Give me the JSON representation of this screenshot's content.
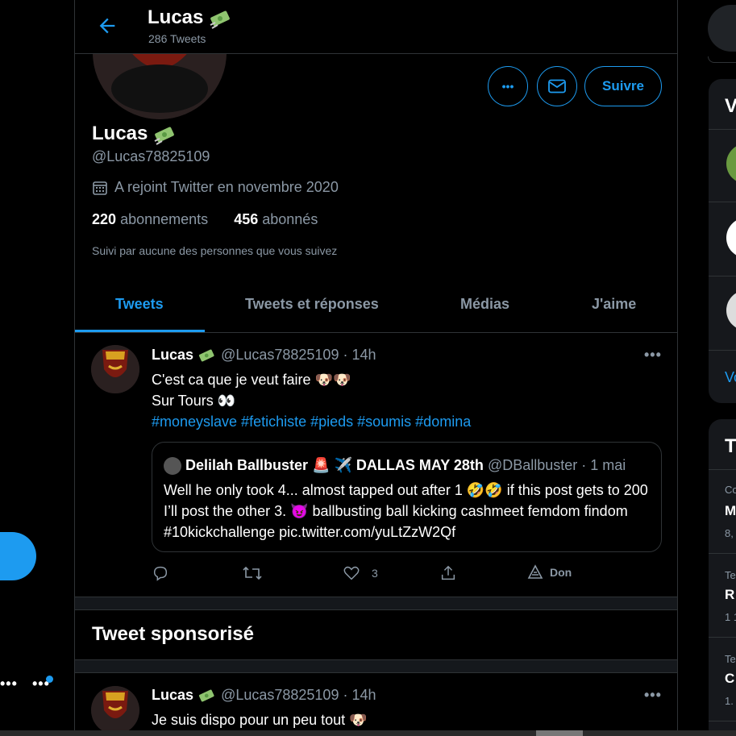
{
  "header": {
    "name": "Lucas",
    "tweet_count": "286 Tweets"
  },
  "profile": {
    "name": "Lucas",
    "handle": "@Lucas78825109",
    "joined": "A rejoint Twitter en novembre 2020",
    "following_count": "220",
    "following_label": "abonnements",
    "followers_count": "456",
    "followers_label": "abonnés",
    "followed_by": "Suivi par aucune des personnes que vous suivez"
  },
  "actions": {
    "more": "•••",
    "follow": "Suivre"
  },
  "tabs": [
    {
      "label": "Tweets",
      "active": true
    },
    {
      "label": "Tweets et réponses",
      "active": false
    },
    {
      "label": "Médias",
      "active": false
    },
    {
      "label": "J'aime",
      "active": false
    }
  ],
  "tweets": [
    {
      "name": "Lucas",
      "handle_time": "@Lucas78825109 · 14h",
      "line1": "C'est ca que je veut faire 🐶🐶",
      "line2": "Sur Tours 👀",
      "hashtags": "#moneyslave #fetichiste #pieds #soumis #domina",
      "quote": {
        "name": "Delilah Ballbuster 🚨 ✈️ DALLAS MAY 28th",
        "handle_time": "@DBallbuster · 1 mai",
        "text": "Well he only took 4... almost tapped out after 1 🤣🤣 if this post gets to 200 I’ll post the other 3. 😈 ballbusting ball kicking cashmeet femdom findom #10kickchallenge pic.twitter.com/yuLtZzW2Qf"
      },
      "likes": "3",
      "donate": "Don"
    },
    {
      "name": "Lucas",
      "handle_time": "@Lucas78825109 · 14h",
      "line1": "Je suis dispo pour un peu tout 🐶"
    }
  ],
  "sponsored_title": "Tweet sponsorisé",
  "sidebar": {
    "who_to_follow_initial": "V",
    "show_more_initial": "Vo",
    "trends_initial": "T",
    "trends": [
      {
        "context": "Co",
        "title": "M",
        "count": "8,"
      },
      {
        "context": "Te",
        "title": "R",
        "count": "1 1"
      },
      {
        "context": "Te",
        "title": "C",
        "count": "1."
      }
    ]
  },
  "left": {
    "more": "•••",
    "more2": "•••"
  },
  "colors": {
    "accent": "#1d9bf0",
    "background": "#000000",
    "border": "#2f3336",
    "secondary_text": "#8b98a5"
  }
}
